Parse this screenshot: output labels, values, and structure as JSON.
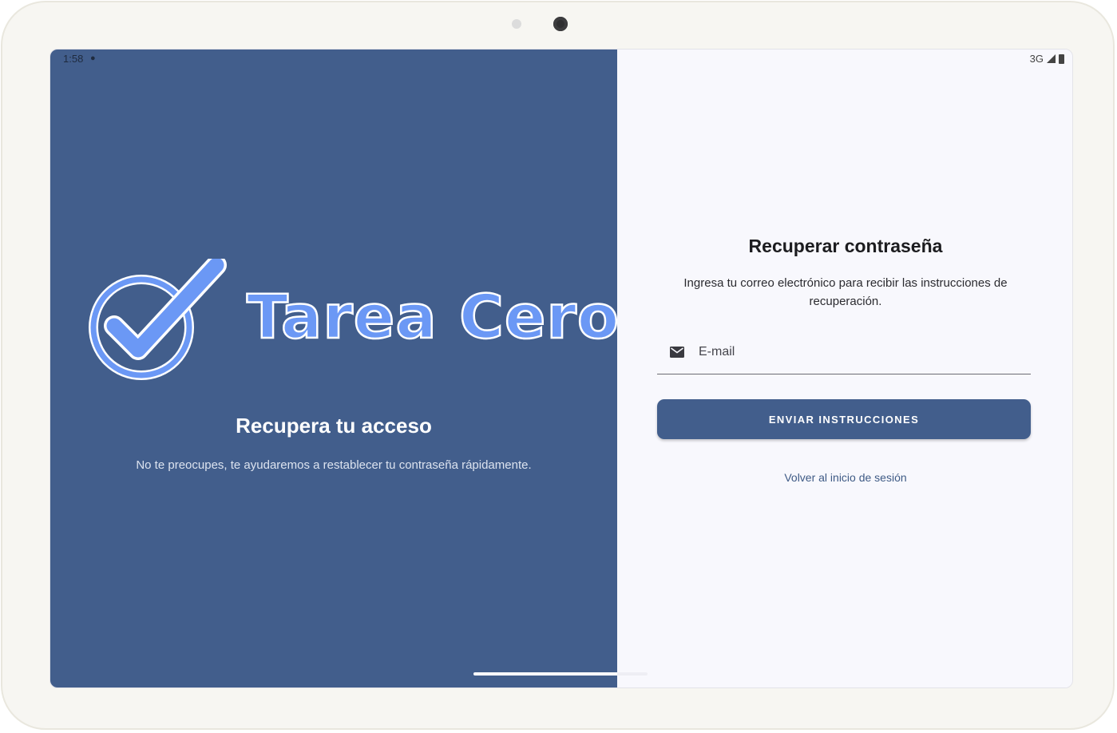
{
  "status_bar": {
    "time": "1:58",
    "network": "3G",
    "mic_icon": "mic-icon",
    "signal_icon": "signal-icon",
    "battery_icon": "battery-icon"
  },
  "brand": {
    "name": "Tarea Cero",
    "logo_icon": "check-circle-icon",
    "logo_color": "#6b98f5"
  },
  "left_panel": {
    "heading": "Recupera tu acceso",
    "subtitle": "No te preocupes, te ayudaremos a restablecer tu contraseña rápidamente.",
    "background": "#425e8c"
  },
  "form": {
    "title": "Recuperar contraseña",
    "description": "Ingresa tu correo electrónico para recibir las instrucciones de recuperación.",
    "email": {
      "placeholder": "E-mail",
      "value": "",
      "icon": "mail-icon"
    },
    "submit_label": "ENVIAR INSTRUCCIONES",
    "back_link": "Volver al inicio de sesión"
  }
}
